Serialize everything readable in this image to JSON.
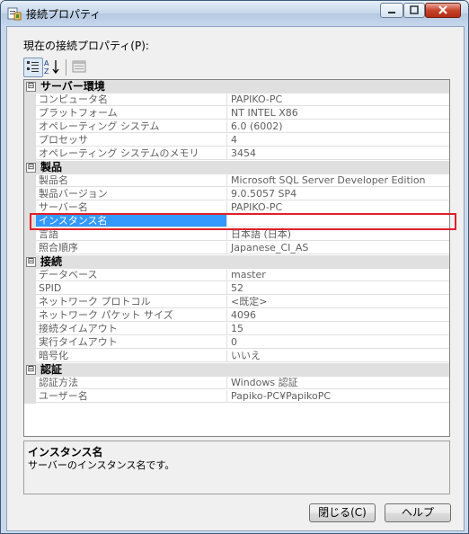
{
  "window": {
    "title": "接続プロパティ"
  },
  "label": "現在の接続プロパティ(P):",
  "grid": {
    "categories": [
      {
        "name": "サーバー環境",
        "expander": "⊟",
        "properties": [
          {
            "name": "コンピュータ名",
            "value": "PAPIKO-PC"
          },
          {
            "name": "プラットフォーム",
            "value": "NT INTEL X86"
          },
          {
            "name": "オペレーティング システム",
            "value": "6.0 (6002)"
          },
          {
            "name": "プロセッサ",
            "value": "4"
          },
          {
            "name": "オペレーティング システムのメモリ",
            "value": "3454"
          }
        ]
      },
      {
        "name": "製品",
        "expander": "⊟",
        "properties": [
          {
            "name": "製品名",
            "value": "Microsoft SQL Server Developer Edition"
          },
          {
            "name": "製品バージョン",
            "value": "9.0.5057 SP4"
          },
          {
            "name": "サーバー名",
            "value": "PAPIKO-PC"
          },
          {
            "name": "インスタンス名",
            "value": ""
          },
          {
            "name": "言語",
            "value": "日本語 (日本)"
          },
          {
            "name": "照合順序",
            "value": "Japanese_CI_AS"
          }
        ]
      },
      {
        "name": "接続",
        "expander": "⊟",
        "properties": [
          {
            "name": "データベース",
            "value": "master"
          },
          {
            "name": "SPID",
            "value": "52"
          },
          {
            "name": "ネットワーク プロトコル",
            "value": "<既定>"
          },
          {
            "name": "ネットワーク パケット サイズ",
            "value": "4096"
          },
          {
            "name": "接続タイムアウト",
            "value": "15"
          },
          {
            "name": "実行タイムアウト",
            "value": "0"
          },
          {
            "name": "暗号化",
            "value": "いいえ"
          }
        ]
      },
      {
        "name": "認証",
        "expander": "⊟",
        "properties": [
          {
            "name": "認証方法",
            "value": "Windows 認証"
          },
          {
            "name": "ユーザー名",
            "value": "Papiko-PC¥PapikoPC"
          }
        ]
      }
    ]
  },
  "description": {
    "title": "インスタンス名",
    "text": "サーバーのインスタンス名です。"
  },
  "buttons": {
    "close": "閉じる(C)",
    "help": "ヘルプ"
  },
  "icons": {
    "app": "properties-window-icon",
    "categorized": "categorized-view-icon",
    "alphabetical": "alphabetical-sort-icon",
    "pages": "property-pages-icon"
  },
  "colors": {
    "selection": "#3399ff",
    "highlight_border": "#e0202a",
    "category_background": "#e0e0e0"
  }
}
